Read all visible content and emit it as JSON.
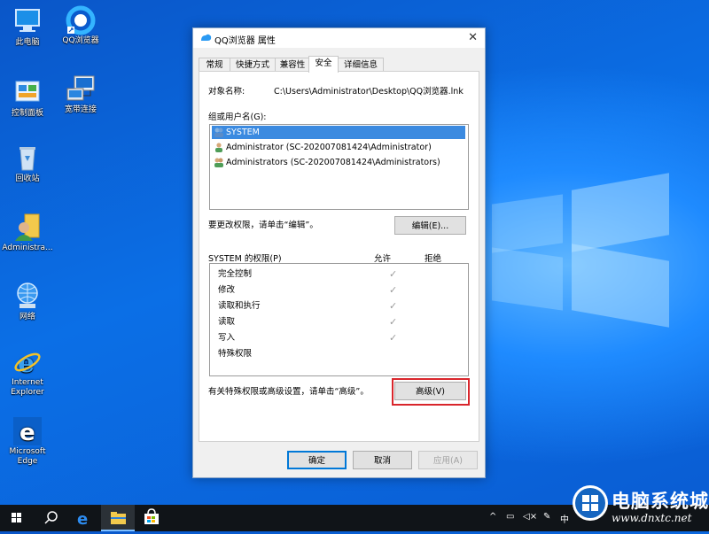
{
  "desktop": {
    "icons": [
      {
        "label": "此电脑",
        "icon": "this-pc-icon"
      },
      {
        "label": "QQ浏览器",
        "icon": "qq-browser-icon"
      },
      {
        "label": "控制面板",
        "icon": "control-panel-icon"
      },
      {
        "label": "宽带连接",
        "icon": "broadband-connection-icon"
      },
      {
        "label": "回收站",
        "icon": "recycle-bin-icon"
      },
      {
        "label": "Administra...",
        "icon": "user-folder-icon"
      },
      {
        "label": "网络",
        "icon": "network-icon"
      },
      {
        "label": "Internet\nExplorer",
        "icon": "internet-explorer-icon"
      },
      {
        "label": "Microsoft\nEdge",
        "icon": "microsoft-edge-icon"
      }
    ]
  },
  "dialog": {
    "title": "QQ浏览器 属性",
    "close_glyph": "✕",
    "tabs": [
      "常规",
      "快捷方式",
      "兼容性",
      "安全",
      "详细信息"
    ],
    "active_tab": "安全",
    "object_name_label": "对象名称:",
    "object_name_value": "C:\\Users\\Administrator\\Desktop\\QQ浏览器.lnk",
    "groups_label": "组或用户名(G):",
    "users": [
      "SYSTEM",
      "Administrator (SC-202007081424\\Administrator)",
      "Administrators (SC-202007081424\\Administrators)"
    ],
    "selected_user": "SYSTEM",
    "edit_hint": "要更改权限，请单击“编辑”。",
    "edit_button": "编辑(E)...",
    "perm_header": "SYSTEM 的权限(P)",
    "allow_header": "允许",
    "deny_header": "拒绝",
    "permissions": [
      {
        "name": "完全控制",
        "allow": true
      },
      {
        "name": "修改",
        "allow": true
      },
      {
        "name": "读取和执行",
        "allow": true
      },
      {
        "name": "读取",
        "allow": true
      },
      {
        "name": "写入",
        "allow": true
      },
      {
        "name": "特殊权限",
        "allow": false
      }
    ],
    "advanced_hint": "有关特殊权限或高级设置，请单击“高级”。",
    "advanced_button": "高级(V)",
    "ok_button": "确定",
    "cancel_button": "取消",
    "apply_button": "应用(A)"
  },
  "taskbar": {
    "items": [
      "start-icon",
      "search-icon",
      "edge-icon",
      "file-explorer-icon",
      "store-icon"
    ],
    "tray": [
      "chevron-up-icon",
      "network-tray-icon",
      "volume-icon",
      "pen-icon",
      "ime-icon"
    ],
    "ime_label": "中"
  },
  "watermark": {
    "main": "电脑系统城",
    "url": "www.dnxtc.net"
  },
  "colors": {
    "selection": "#3b8ae0",
    "highlight_box": "#d9262c",
    "default_button_border": "#0078d7"
  }
}
